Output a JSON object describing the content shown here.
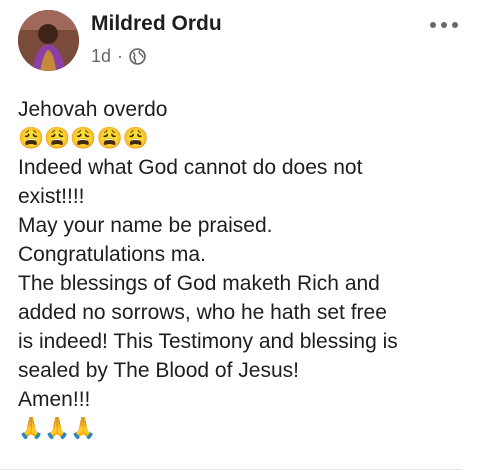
{
  "post": {
    "author": "Mildred Ordu",
    "time": "1d",
    "separator": "·",
    "privacy_icon": "globe-icon",
    "more_icon": "more-horizontal-icon",
    "lines": [
      "Jehovah overdo",
      "😩😩😩😩😩",
      "Indeed what God cannot do does not",
      "exist!!!!",
      "May your name be praised.",
      "Congratulations ma.",
      "The blessings of God maketh Rich and",
      "added no sorrows, who he hath set free",
      "is indeed! This Testimony and blessing is",
      "sealed by The Blood of Jesus!",
      "Amen!!!",
      "🙏🙏🙏"
    ]
  }
}
